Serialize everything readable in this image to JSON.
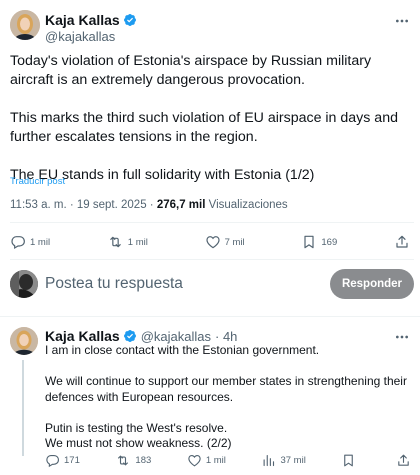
{
  "tweet": {
    "author_name": "Kaja Kallas",
    "author_handle": "@kajakallas",
    "paragraphs": [
      "Today's violation of Estonia's airspace by Russian military aircraft is an extremely dangerous provocation.",
      "This marks the third such violation of EU airspace in days and further escalates tensions in the region.",
      "The EU stands in full solidarity with Estonia (1/2)"
    ],
    "translate_label": "Traducir post",
    "timestamp": "11:53 a. m. · 19 sept. 2025 ·",
    "views_count": "276,7 mil",
    "views_label": "Visualizaciones",
    "actions": {
      "replies": "1 mil",
      "reposts": "1 mil",
      "likes": "7 mil",
      "bookmarks": "169"
    }
  },
  "reply_composer": {
    "placeholder": "Postea tu respuesta",
    "button_label": "Responder"
  },
  "reply": {
    "author_name": "Kaja Kallas",
    "author_handle": "@kajakallas",
    "time": "· 4h",
    "paragraphs": [
      "I am in close contact with the Estonian government.",
      "We will continue to support our member states in strengthening their defences with European resources.",
      "Putin is testing the West's resolve.\nWe must not show weakness. (2/2)"
    ],
    "actions": {
      "replies": "171",
      "reposts": "183",
      "likes": "1 mil",
      "views": "37 mil"
    }
  },
  "colors": {
    "verified": "#1d9bf0",
    "link": "#1d9bf0",
    "secondary_text": "#536471",
    "button_bg": "#8a8c8f"
  }
}
